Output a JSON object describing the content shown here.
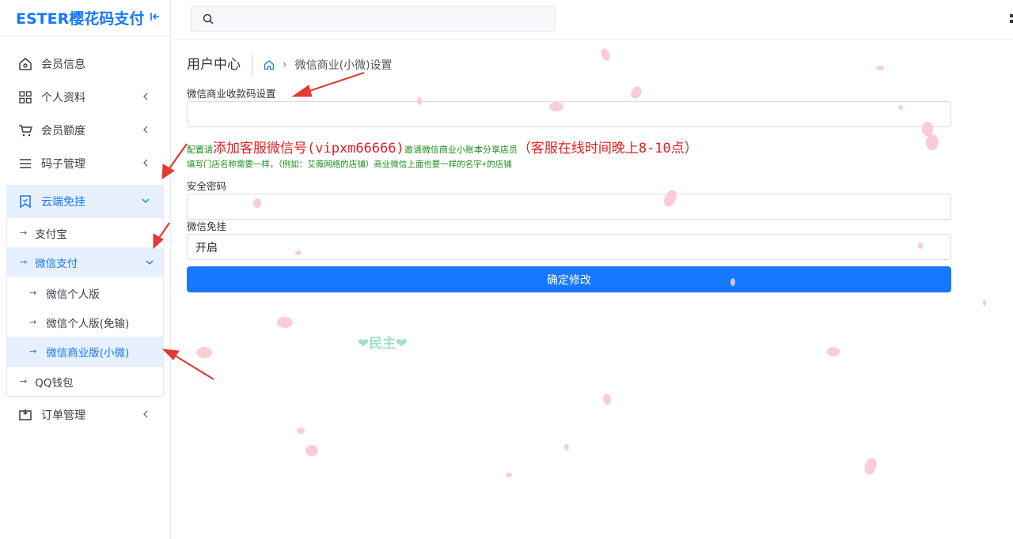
{
  "brand": {
    "title": "ESTER樱花码支付"
  },
  "sidebar": {
    "items": [
      {
        "label": "会员信息"
      },
      {
        "label": "个人资料"
      },
      {
        "label": "会员额度"
      },
      {
        "label": "码子管理"
      },
      {
        "label": "云端免挂"
      },
      {
        "label": "订单管理"
      }
    ],
    "sub": [
      {
        "label": "支付宝"
      },
      {
        "label": "微信支付"
      },
      {
        "label": "QQ钱包"
      }
    ],
    "subsub": [
      {
        "label": "微信个人版"
      },
      {
        "label": "微信个人版(免输)"
      },
      {
        "label": "微信商业版(小微)"
      }
    ]
  },
  "header": {
    "search_placeholder": ""
  },
  "breadcrumb": {
    "title": "用户中心",
    "current": "微信商业(小微)设置"
  },
  "form": {
    "qr_label": "微信商业收款码设置",
    "qr_value": "",
    "notice_prefix": "配置请",
    "notice_red1": "添加客服微信号(vipxm66666)",
    "notice_mid": "邀请微信商业小账本分享店员",
    "notice_red2": "（客服在线时间晚上8-10点）",
    "notice_line2": "填写门店名称需要一样，（例如：艾薇网络的店铺）商业微信上面也要一样的名字+的店铺",
    "password_label": "安全密码",
    "password_value": "",
    "mode_label": "微信免挂",
    "mode_value": "开启",
    "submit_label": "确定修改"
  },
  "watermark": "❤民主❤",
  "colors": {
    "accent": "#1677ff",
    "active_bg": "#e7f0ff",
    "notice_green": "#1a8f1a",
    "notice_red": "#e02020",
    "annotation_arrow": "#e53935"
  }
}
